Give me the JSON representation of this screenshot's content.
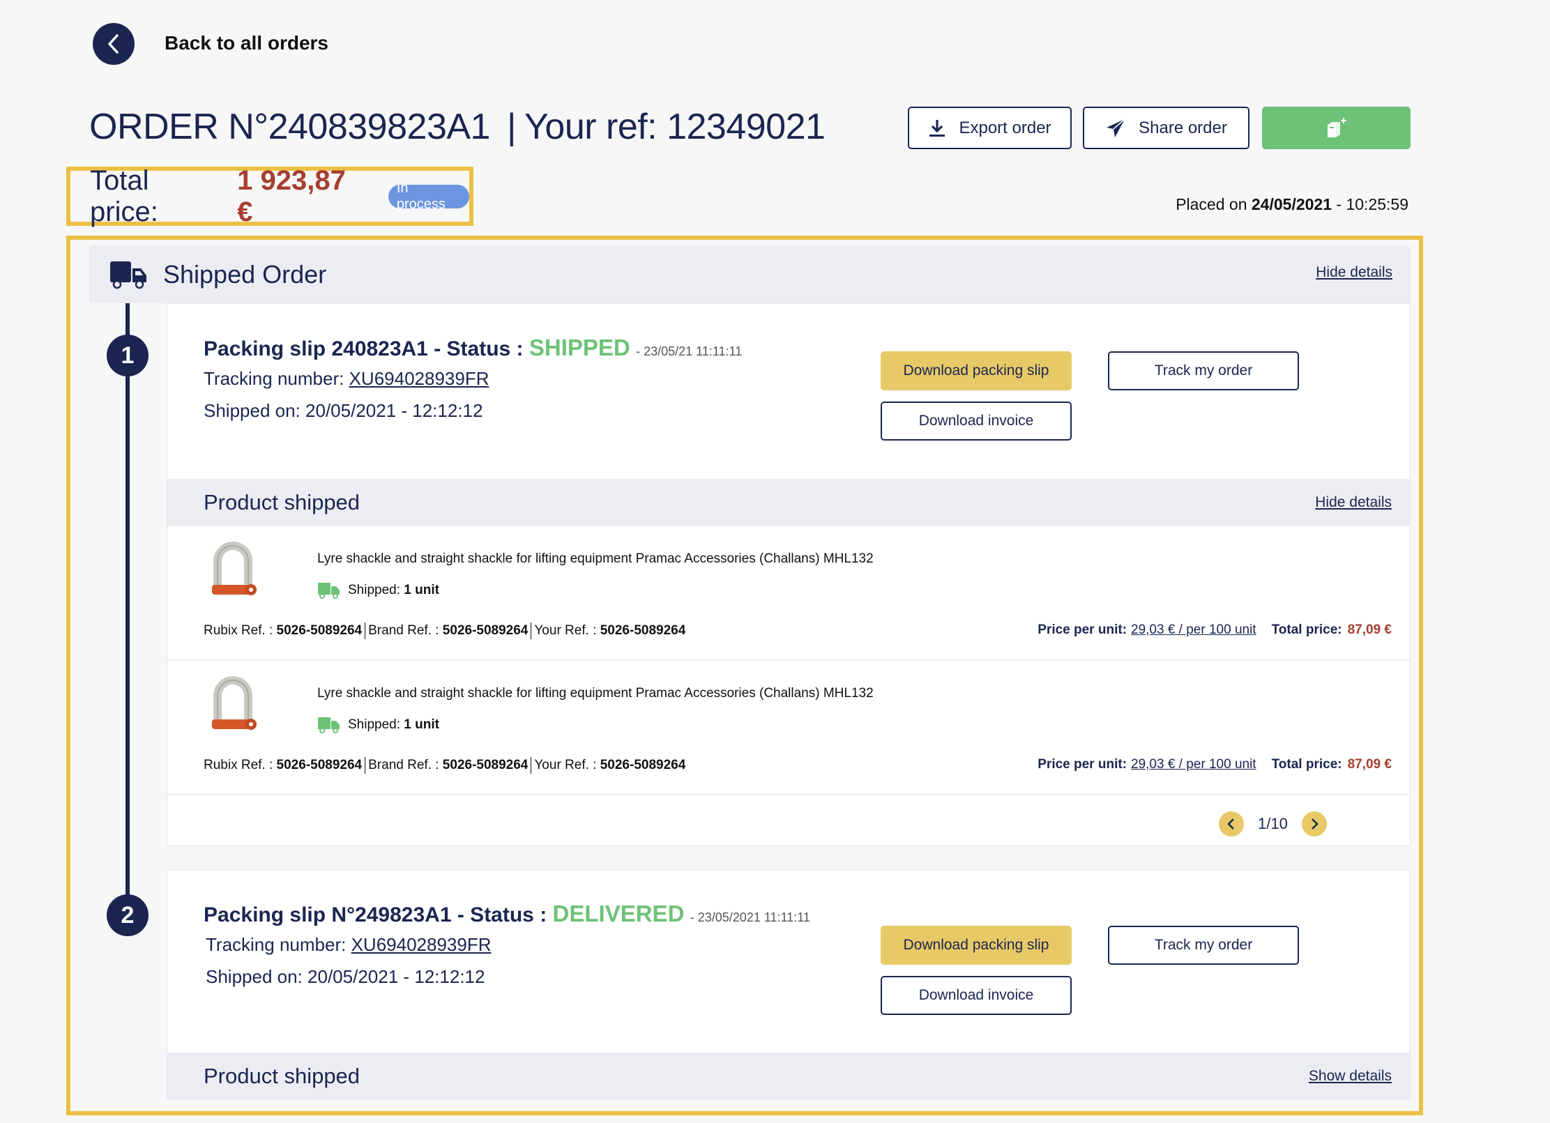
{
  "nav": {
    "back_label": "Back to all orders"
  },
  "header": {
    "order_title": "ORDER N°240839823A1",
    "ref_separator": "|",
    "your_ref": "Your ref: 12349021",
    "export_label": "Export order",
    "share_label": "Share order",
    "add_to_cart_icon": "box-plus-icon"
  },
  "summary": {
    "total_label": "Total price:",
    "total_value": "1 923,87 €",
    "status_badge": "In process",
    "placed_on_prefix": "Placed on",
    "placed_on_date": "24/05/2021",
    "placed_on_time": "- 10:25:59"
  },
  "shipped_order": {
    "title": "Shipped Order",
    "toggle_label": "Hide details",
    "packing_slips": [
      {
        "step": "1",
        "title": "Packing slip 240823A1 - Status :",
        "status": "SHIPPED",
        "status_date": "- 23/05/21 11:11:11",
        "tracking_label": "Tracking number:",
        "tracking_number": "XU694028939FR",
        "shipped_on_label": "Shipped on:",
        "shipped_on_value": "20/05/2021 - 12:12:12",
        "download_slip_label": "Download packing slip",
        "download_invoice_label": "Download invoice",
        "track_label": "Track my order",
        "products_header": "Product shipped",
        "products_toggle": "Hide details",
        "products": [
          {
            "name": "Lyre shackle and straight shackle for lifting equipment Pramac Accessories (Challans) MHL132",
            "shipped_label": "Shipped:",
            "shipped_qty": "1 unit",
            "rubix_ref_label": "Rubix Ref. :",
            "rubix_ref": "5026-5089264",
            "brand_ref_label": "Brand Ref. :",
            "brand_ref": "5026-5089264",
            "your_ref_label": "Your Ref. :",
            "your_ref": "5026-5089264",
            "price_per_unit_label": "Price per unit:",
            "price_per_unit": "29,03 € / per 100 unit",
            "total_price_label": "Total price:",
            "total_price": "87,09 €"
          },
          {
            "name": "Lyre shackle and straight shackle for lifting equipment Pramac Accessories (Challans) MHL132",
            "shipped_label": "Shipped:",
            "shipped_qty": "1 unit",
            "rubix_ref_label": "Rubix Ref. :",
            "rubix_ref": "5026-5089264",
            "brand_ref_label": "Brand Ref. :",
            "brand_ref": "5026-5089264",
            "your_ref_label": "Your Ref. :",
            "your_ref": "5026-5089264",
            "price_per_unit_label": "Price per unit:",
            "price_per_unit": "29,03 € / per 100 unit",
            "total_price_label": "Total price:",
            "total_price": "87,09 €"
          }
        ],
        "pagination": "1/10"
      },
      {
        "step": "2",
        "title": "Packing slip N°249823A1 - Status :",
        "status": "DELIVERED",
        "status_date": "- 23/05/2021 11:11:11",
        "tracking_label": "Tracking number:",
        "tracking_number": "XU694028939FR",
        "shipped_on_label": "Shipped on:",
        "shipped_on_value": "20/05/2021 - 12:12:12",
        "download_slip_label": "Download packing slip",
        "download_invoice_label": "Download invoice",
        "track_label": "Track my order",
        "products_header": "Product shipped",
        "products_toggle": "Show details"
      }
    ]
  },
  "colors": {
    "navy": "#1b2550",
    "highlight_yellow": "#ecc044",
    "button_yellow": "#e8c967",
    "green": "#6dc277",
    "price_red": "#a63f30",
    "badge_blue": "#6b95df"
  }
}
